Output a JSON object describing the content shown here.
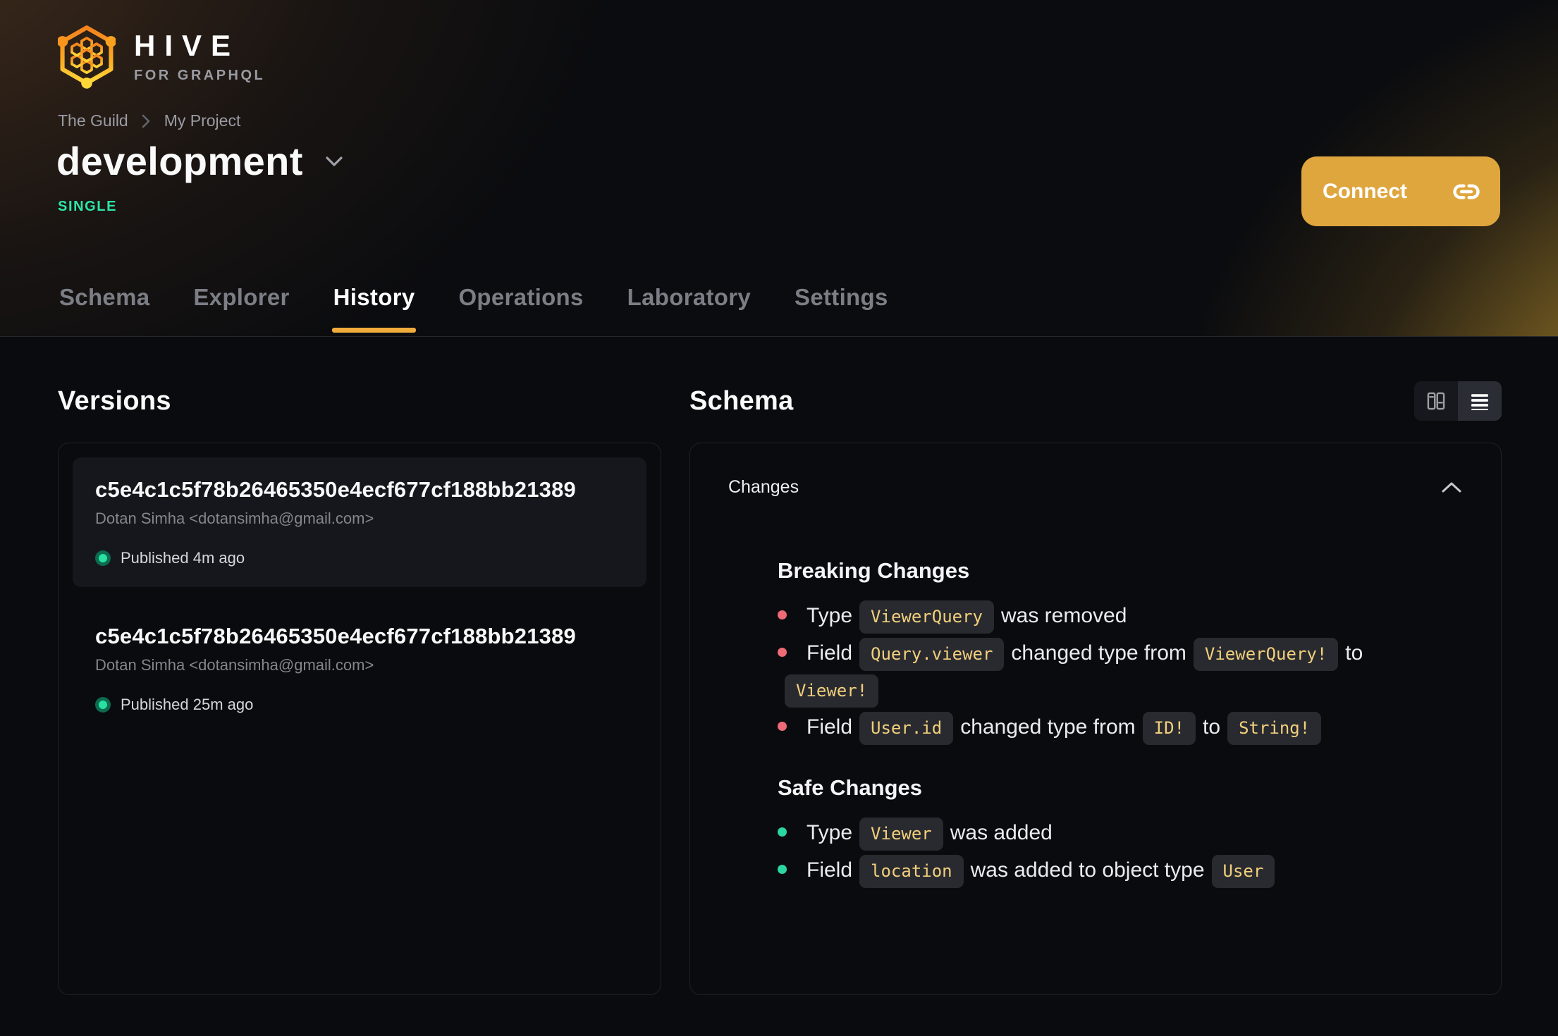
{
  "brand": {
    "name": "HIVE",
    "tagline": "FOR GRAPHQL"
  },
  "breadcrumb": {
    "org": "The Guild",
    "project": "My Project"
  },
  "target": {
    "name": "development",
    "badge": "SINGLE"
  },
  "connect": {
    "label": "Connect"
  },
  "tabs": [
    {
      "label": "Schema"
    },
    {
      "label": "Explorer"
    },
    {
      "label": "History"
    },
    {
      "label": "Operations"
    },
    {
      "label": "Laboratory"
    },
    {
      "label": "Settings"
    }
  ],
  "versions": {
    "heading": "Versions",
    "items": [
      {
        "hash": "c5e4c1c5f78b26465350e4ecf677cf188bb21389",
        "author": "Dotan Simha <dotansimha@gmail.com>",
        "status": "Published 4m ago"
      },
      {
        "hash": "c5e4c1c5f78b26465350e4ecf677cf188bb21389",
        "author": "Dotan Simha <dotansimha@gmail.com>",
        "status": "Published 25m ago"
      }
    ]
  },
  "schema": {
    "heading": "Schema",
    "changes_label": "Changes",
    "breaking": {
      "title": "Breaking Changes",
      "items": [
        {
          "t0": "Type",
          "c0": "ViewerQuery",
          "t1": "was removed"
        },
        {
          "t0": "Field",
          "c0": "Query.viewer",
          "t1": "changed type from",
          "c1": "ViewerQuery!",
          "t2": "to",
          "c2": "Viewer!"
        },
        {
          "t0": "Field",
          "c0": "User.id",
          "t1": "changed type from",
          "c1": "ID!",
          "t2": "to",
          "c2": "String!"
        }
      ]
    },
    "safe": {
      "title": "Safe Changes",
      "items": [
        {
          "t0": "Type",
          "c0": "Viewer",
          "t1": "was added"
        },
        {
          "t0": "Field",
          "c0": "location",
          "t1": "was added to object type",
          "c1": "User"
        }
      ]
    }
  },
  "colors": {
    "accent": "#f0ad3c",
    "connect_bg": "#dfa63e",
    "badge_green": "#2ce6a7",
    "chip_text": "#f2d07b",
    "bullet_red": "#ee6a76",
    "bullet_green": "#2bd7a0"
  }
}
